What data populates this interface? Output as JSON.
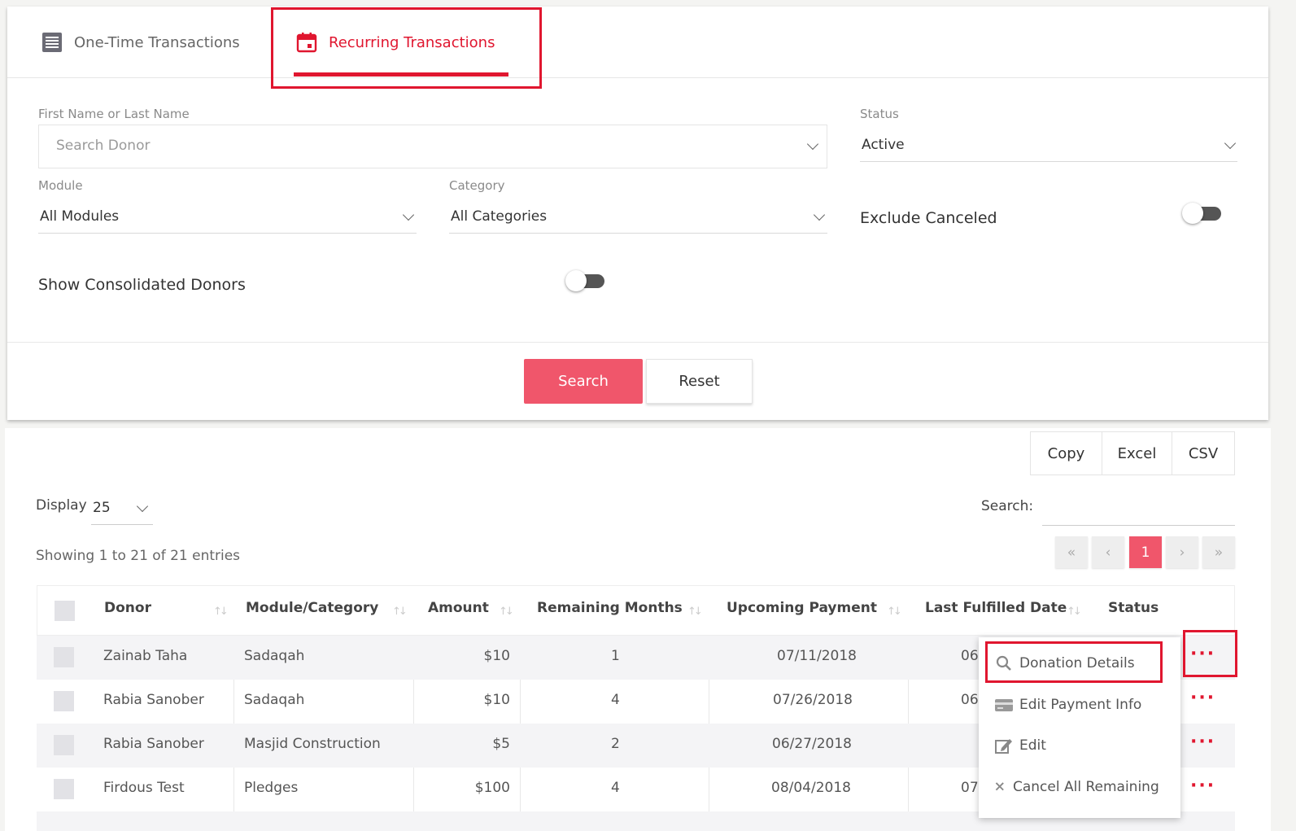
{
  "tabs": {
    "one_time": "One-Time Transactions",
    "recurring": "Recurring Transactions"
  },
  "filters": {
    "name_label": "First Name or Last Name",
    "name_placeholder": "Search Donor",
    "status_label": "Status",
    "status_value": "Active",
    "module_label": "Module",
    "module_value": "All Modules",
    "category_label": "Category",
    "category_value": "All Categories",
    "exclude_canceled_label": "Exclude Canceled",
    "consolidated_label": "Show Consolidated Donors"
  },
  "buttons": {
    "search": "Search",
    "reset": "Reset"
  },
  "export": {
    "copy": "Copy",
    "excel": "Excel",
    "csv": "CSV"
  },
  "table_controls": {
    "display_label": "Display",
    "display_value": "25",
    "search_label": "Search:",
    "showing": "Showing 1 to 21 of 21 entries",
    "current_page": "1"
  },
  "pagination_glyphs": {
    "first": "«",
    "prev": "‹",
    "next": "›",
    "last": "»"
  },
  "table": {
    "headers": [
      "Donor",
      "Module/Category",
      "Amount",
      "Remaining Months",
      "Upcoming Payment",
      "Last Fulfilled Date",
      "Status"
    ],
    "rows": [
      {
        "donor": "Zainab Taha",
        "module": "Sadaqah",
        "amount": "$10",
        "remaining": "1",
        "upcoming": "07/11/2018",
        "last": "06"
      },
      {
        "donor": "Rabia Sanober",
        "module": "Sadaqah",
        "amount": "$10",
        "remaining": "4",
        "upcoming": "07/26/2018",
        "last": "06"
      },
      {
        "donor": "Rabia Sanober",
        "module": "Masjid Construction",
        "amount": "$5",
        "remaining": "2",
        "upcoming": "06/27/2018",
        "last": ""
      },
      {
        "donor": "Firdous Test",
        "module": "Pledges",
        "amount": "$100",
        "remaining": "4",
        "upcoming": "08/04/2018",
        "last": "07,"
      }
    ],
    "row_action": "···"
  },
  "context_menu": {
    "items": [
      "Donation Details",
      "Edit Payment Info",
      "Edit",
      "Cancel All Remaining"
    ]
  },
  "colors": {
    "accent": "#e0162f",
    "button": "#f0566b"
  }
}
